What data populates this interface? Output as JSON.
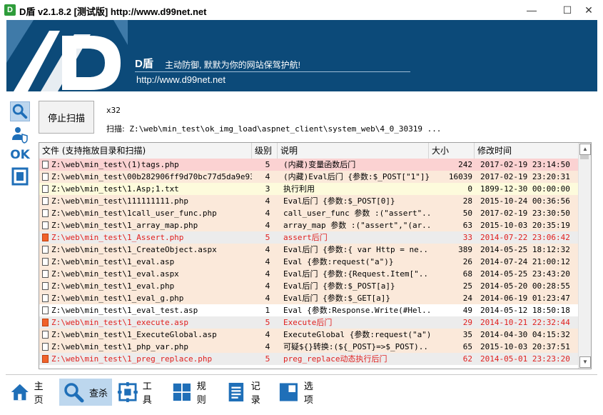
{
  "window": {
    "title": "D盾 v2.1.8.2 [测试版] http://www.d99net.net",
    "logo_letter": "D"
  },
  "banner": {
    "name": "D盾",
    "slogan": "主动防御, 默默为你的网站保驾护航!",
    "url": "http://www.d99net.net",
    "bg_color": "#0c4a79"
  },
  "sidebar": {
    "icons": [
      "search-icon",
      "user-shield-icon",
      "ok-icon",
      "frame-icon"
    ],
    "ok_label": "OK"
  },
  "scan": {
    "stop_button": "停止扫描",
    "threads": "x32",
    "path_label": "扫描:",
    "path": "Z:\\web\\min_test\\ok_img_load\\aspnet_client\\system_web\\4_0_30319 ..."
  },
  "table": {
    "headers": [
      "文件 (支持拖放目录和扫描)",
      "级别",
      "说明",
      "大小",
      "修改时间"
    ],
    "rows": [
      {
        "file": "Z:\\web\\min_test\\(1)tags.php",
        "level": "5",
        "desc": "(内藏)变量函数后门",
        "size": "242",
        "time": "2017-02-19 23:14:50",
        "style": "pink",
        "icon": "file"
      },
      {
        "file": "Z:\\web\\min_test\\00b282906ff9d70bc77d5da9e93...",
        "level": "4",
        "desc": "(内藏)Eval后门 {参数:$_POST[\"1\"]}",
        "size": "16039",
        "time": "2017-02-19 23:20:31",
        "style": "peach",
        "icon": "file"
      },
      {
        "file": "Z:\\web\\min_test\\1.Asp;1.txt",
        "level": "3",
        "desc": "执行利用",
        "size": "0",
        "time": "1899-12-30 00:00:00",
        "style": "yellow",
        "icon": "file"
      },
      {
        "file": "Z:\\web\\min_test\\111111111.php",
        "level": "4",
        "desc": "Eval后门 {参数:$_POST[0]}",
        "size": "28",
        "time": "2015-10-24 00:36:56",
        "style": "peach",
        "icon": "file"
      },
      {
        "file": "Z:\\web\\min_test\\1call_user_func.php",
        "level": "4",
        "desc": "call_user_func 参数 :(\"assert\"...",
        "size": "50",
        "time": "2017-02-19 23:30:50",
        "style": "peach",
        "icon": "file"
      },
      {
        "file": "Z:\\web\\min_test\\1_array_map.php",
        "level": "4",
        "desc": "array_map 参数 :(\"assert\",\"(ar...",
        "size": "63",
        "time": "2015-10-03 20:35:19",
        "style": "peach",
        "icon": "file"
      },
      {
        "file": "Z:\\web\\min_test\\1_Assert.php",
        "level": "5",
        "desc": "assert后门",
        "size": "33",
        "time": "2014-07-22 23:06:42",
        "style": "red",
        "icon": "red"
      },
      {
        "file": "Z:\\web\\min_test\\1_CreateObject.aspx",
        "level": "4",
        "desc": "Eval后门 {参数:{ var Http = ne...",
        "size": "389",
        "time": "2014-05-25 18:12:32",
        "style": "peach",
        "icon": "file"
      },
      {
        "file": "Z:\\web\\min_test\\1_eval.asp",
        "level": "4",
        "desc": "Eval {参数:request(\"a\")}",
        "size": "26",
        "time": "2014-07-24 21:00:12",
        "style": "peach",
        "icon": "file"
      },
      {
        "file": "Z:\\web\\min_test\\1_eval.aspx",
        "level": "4",
        "desc": "Eval后门 {参数:{Request.Item[\"...",
        "size": "68",
        "time": "2014-05-25 23:43:20",
        "style": "peach",
        "icon": "file"
      },
      {
        "file": "Z:\\web\\min_test\\1_eval.php",
        "level": "4",
        "desc": "Eval后门 {参数:$_POST[a]}",
        "size": "25",
        "time": "2014-05-20 00:28:55",
        "style": "peach",
        "icon": "file"
      },
      {
        "file": "Z:\\web\\min_test\\1_eval_g.php",
        "level": "4",
        "desc": "Eval后门 {参数:$_GET[a]}",
        "size": "24",
        "time": "2014-06-19 01:23:47",
        "style": "peach",
        "icon": "file"
      },
      {
        "file": "Z:\\web\\min_test\\1_eval_test.asp",
        "level": "1",
        "desc": "Eval {参数:Response.Write(#Hel...",
        "size": "49",
        "time": "2014-05-12 18:50:18",
        "style": "white",
        "icon": "file"
      },
      {
        "file": "Z:\\web\\min_test\\1_execute.asp",
        "level": "5",
        "desc": "Execute后门",
        "size": "29",
        "time": "2014-10-21 22:32:44",
        "style": "red",
        "icon": "red"
      },
      {
        "file": "Z:\\web\\min_test\\1_ExecuteGlobal.asp",
        "level": "4",
        "desc": "ExecuteGlobal {参数:request(\"a\")}",
        "size": "35",
        "time": "2014-04-30 04:15:32",
        "style": "peach",
        "icon": "file"
      },
      {
        "file": "Z:\\web\\min_test\\1_php_var.php",
        "level": "4",
        "desc": "可疑${}转换:(${_POST}=>$_POST)...",
        "size": "65",
        "time": "2015-10-03 20:37:51",
        "style": "peach",
        "icon": "file"
      },
      {
        "file": "Z:\\web\\min_test\\1_preg_replace.php",
        "level": "5",
        "desc": "preg_replace动态执行后门",
        "size": "62",
        "time": "2014-05-01 23:23:20",
        "style": "red",
        "icon": "red"
      }
    ]
  },
  "row_colors": {
    "pink": {
      "bg": "#fbd2d2",
      "fg": "#000000"
    },
    "peach": {
      "bg": "#fbe9da",
      "fg": "#000000"
    },
    "yellow": {
      "bg": "#fdfbdc",
      "fg": "#000000"
    },
    "white": {
      "bg": "#ffffff",
      "fg": "#000000"
    },
    "red": {
      "bg": "#ececec",
      "fg": "#e0201f"
    }
  },
  "nav": {
    "items": [
      {
        "label": "主页",
        "icon": "home-icon"
      },
      {
        "label": "查杀",
        "icon": "search-icon"
      },
      {
        "label": "工具",
        "icon": "tools-icon"
      },
      {
        "label": "规则",
        "icon": "grid-icon"
      },
      {
        "label": "记录",
        "icon": "document-icon"
      },
      {
        "label": "选项",
        "icon": "options-icon"
      }
    ],
    "active": "查杀"
  }
}
